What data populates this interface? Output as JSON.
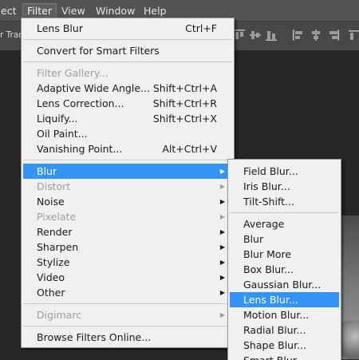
{
  "menubar": {
    "items": [
      {
        "label": "ect"
      },
      {
        "label": "Filter"
      },
      {
        "label": "View"
      },
      {
        "label": "Window"
      },
      {
        "label": "Help"
      }
    ]
  },
  "optionsbar": {
    "label": "r Trans"
  },
  "filter_menu": {
    "items": [
      {
        "label": "Lens Blur",
        "shortcut": "Ctrl+F"
      },
      {
        "label": "Convert for Smart Filters"
      },
      {
        "label": "Filter Gallery..."
      },
      {
        "label": "Adaptive Wide Angle...",
        "shortcut": "Shift+Ctrl+A"
      },
      {
        "label": "Lens Correction...",
        "shortcut": "Shift+Ctrl+R"
      },
      {
        "label": "Liquify...",
        "shortcut": "Shift+Ctrl+X"
      },
      {
        "label": "Oil Paint..."
      },
      {
        "label": "Vanishing Point...",
        "shortcut": "Alt+Ctrl+V"
      },
      {
        "label": "Blur"
      },
      {
        "label": "Distort"
      },
      {
        "label": "Noise"
      },
      {
        "label": "Pixelate"
      },
      {
        "label": "Render"
      },
      {
        "label": "Sharpen"
      },
      {
        "label": "Stylize"
      },
      {
        "label": "Video"
      },
      {
        "label": "Other"
      },
      {
        "label": "Digimarc"
      },
      {
        "label": "Browse Filters Online..."
      }
    ]
  },
  "blur_submenu": {
    "items": [
      {
        "label": "Field Blur..."
      },
      {
        "label": "Iris Blur..."
      },
      {
        "label": "Tilt-Shift..."
      },
      {
        "label": "Average"
      },
      {
        "label": "Blur"
      },
      {
        "label": "Blur More"
      },
      {
        "label": "Box Blur..."
      },
      {
        "label": "Gaussian Blur..."
      },
      {
        "label": "Lens Blur..."
      },
      {
        "label": "Motion Blur..."
      },
      {
        "label": "Radial Blur..."
      },
      {
        "label": "Shape Blur..."
      },
      {
        "label": "Smart Blur..."
      }
    ]
  },
  "colors": {
    "highlight": "#3593f6",
    "menu_bg": "#f0f0f0",
    "disabled_text": "#9e9e9e"
  }
}
